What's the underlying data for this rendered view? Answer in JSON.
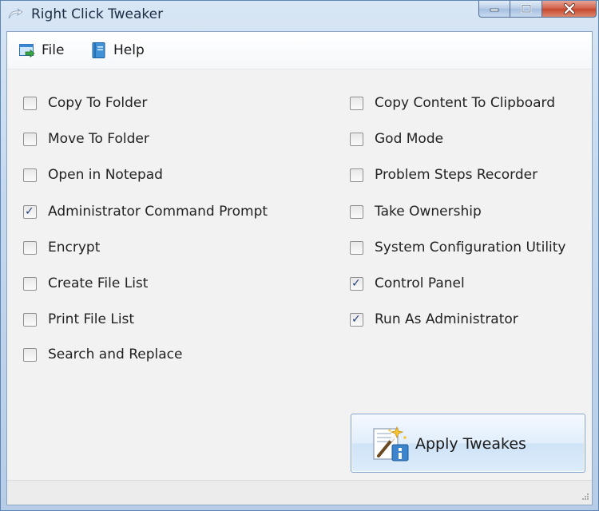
{
  "window": {
    "title": "Right Click Tweaker"
  },
  "menu": {
    "file_label": "File",
    "help_label": "Help"
  },
  "options": {
    "left": [
      {
        "label": "Copy To Folder",
        "checked": false
      },
      {
        "label": "Move To Folder",
        "checked": false
      },
      {
        "label": "Open in Notepad",
        "checked": false
      },
      {
        "label": "Administrator Command Prompt",
        "checked": true
      },
      {
        "label": "Encrypt",
        "checked": false
      },
      {
        "label": "Create File List",
        "checked": false
      },
      {
        "label": "Print File List",
        "checked": false
      },
      {
        "label": "Search and Replace",
        "checked": false
      }
    ],
    "right": [
      {
        "label": "Copy Content To Clipboard",
        "checked": false
      },
      {
        "label": "God Mode",
        "checked": false
      },
      {
        "label": "Problem Steps Recorder",
        "checked": false
      },
      {
        "label": "Take Ownership",
        "checked": false
      },
      {
        "label": "System Configuration Utility",
        "checked": false
      },
      {
        "label": "Control Panel",
        "checked": true
      },
      {
        "label": "Run As Administrator",
        "checked": true
      }
    ]
  },
  "apply_button": {
    "label": "Apply Tweakes",
    "icon": "magic-wand-icon"
  },
  "check_glyph": "✓",
  "colors": {
    "titlebar": "#c4d8ee",
    "client_bg": "#f2f2f2",
    "close_button": "#c6462c",
    "button_border": "#7da2ce",
    "check": "#22407a"
  }
}
